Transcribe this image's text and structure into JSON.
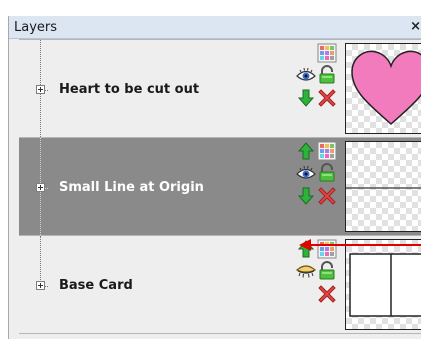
{
  "panel": {
    "title": "Layers",
    "close_glyph": "×"
  },
  "layers": [
    {
      "name": "Heart to be cut out",
      "selected": false,
      "visible": true,
      "buttons": [
        "grid-icon",
        "eye-icon",
        "lock-icon",
        "move-down-icon",
        "delete-icon"
      ],
      "thumbnail": "heart"
    },
    {
      "name": "Small Line at Origin",
      "selected": true,
      "visible": true,
      "buttons": [
        "move-up-icon",
        "grid-icon",
        "eye-icon",
        "lock-icon",
        "move-down-icon",
        "delete-icon"
      ],
      "thumbnail": "line"
    },
    {
      "name": "Base Card",
      "selected": false,
      "visible": false,
      "buttons": [
        "move-up-icon",
        "grid-icon",
        "eye-closed-icon",
        "lock-icon",
        "delete-icon"
      ],
      "thumbnail": "card"
    }
  ],
  "colors": {
    "heart_fill": "#f27bbd",
    "selected_row": "#8a8a8a",
    "annotation_arrow": "#e00000"
  }
}
